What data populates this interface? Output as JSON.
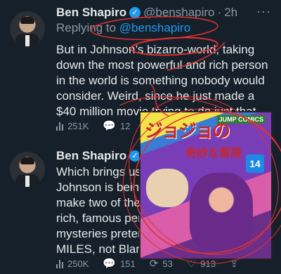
{
  "tweet1": {
    "name": "Ben Shapiro",
    "handle": "@benshapiro",
    "dot": "·",
    "time": "2h",
    "reply_prefix": "Replying to",
    "reply_handle": "@benshapiro",
    "text": "But in Johnson’s bizarro-world, taking down the most powerful and rich person in the world is something nobody would consider. Weird, since he just made a $40 million movie trying to do just that.",
    "views": "251K",
    "replies": "12"
  },
  "tweet2": {
    "name": "Ben Shapiro",
    "text_lines": [
      "Which brings us",
      "Johnson is being",
      "make two of thes",
      "rich, famous pers",
      "mysteries preten",
      "MILES, not Bland"
    ],
    "views": "250K",
    "replies": "151",
    "retweets": "53",
    "likes": "913"
  },
  "overlay": {
    "title": "ジョジョの",
    "subtitle": "奇妙な冒険",
    "publisher": "JUMP COMICS",
    "volume": "14"
  },
  "icons": {
    "verified": "✓",
    "more": "···",
    "reply": "💬",
    "retweet": "⟳",
    "like": "♡",
    "share": "⇪"
  }
}
